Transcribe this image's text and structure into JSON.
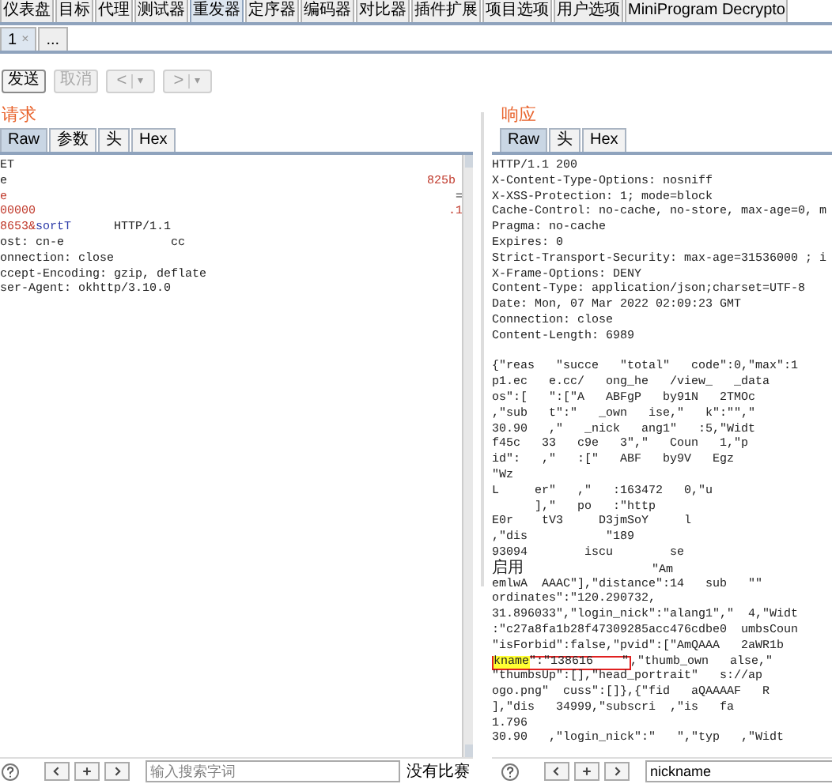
{
  "main_tabs": [
    {
      "label": "仪表盘",
      "selected": false
    },
    {
      "label": "目标",
      "selected": false
    },
    {
      "label": "代理",
      "selected": false
    },
    {
      "label": "测试器",
      "selected": false
    },
    {
      "label": "重发器",
      "selected": true
    },
    {
      "label": "定序器",
      "selected": false
    },
    {
      "label": "编码器",
      "selected": false
    },
    {
      "label": "对比器",
      "selected": false
    },
    {
      "label": "插件扩展",
      "selected": false
    },
    {
      "label": "项目选项",
      "selected": false
    },
    {
      "label": "用户选项",
      "selected": false
    },
    {
      "label": "MiniProgram Decrypto",
      "selected": false
    }
  ],
  "sub_tabs": [
    {
      "label": "1",
      "close": "×",
      "selected": true
    },
    {
      "label": "...",
      "selected": false
    }
  ],
  "toolbar": {
    "send": {
      "label": "发送",
      "disabled": false
    },
    "cancel": {
      "label": "取消",
      "disabled": true
    },
    "back": {
      "label": "<",
      "caret": "▾"
    },
    "forward": {
      "label": ">",
      "caret": "▾"
    }
  },
  "request": {
    "title": "请求",
    "tabs": [
      {
        "label": "Raw",
        "selected": true
      },
      {
        "label": "参数",
        "selected": false
      },
      {
        "label": "头",
        "selected": false
      },
      {
        "label": "Hex",
        "selected": false
      }
    ],
    "lines": [
      [
        {
          "text": "ET",
          "kind": "plain"
        }
      ],
      [
        {
          "text": "e",
          "kind": "plain"
        },
        {
          "text": "                                                           825b",
          "kind": "value"
        }
      ],
      [
        {
          "text": "e",
          "kind": "value"
        },
        {
          "text": "                                                               =",
          "kind": "plain"
        }
      ],
      [
        {
          "text": "00000",
          "kind": "value"
        },
        {
          "text": "                                                          .1",
          "kind": "value"
        }
      ],
      [
        {
          "text": "8653&",
          "kind": "value"
        },
        {
          "text": "sortT",
          "kind": "name"
        },
        {
          "text": "      HTTP/1.1",
          "kind": "plain"
        }
      ],
      [
        {
          "text": "ost: cn-e",
          "kind": "plain"
        },
        {
          "text": "               cc",
          "kind": "plain"
        }
      ],
      [
        {
          "text": "onnection: close",
          "kind": "plain"
        }
      ],
      [
        {
          "text": "ccept-Encoding: gzip, deflate",
          "kind": "plain"
        }
      ],
      [
        {
          "text": "ser-Agent: okhttp/3.10.0",
          "kind": "plain"
        }
      ]
    ],
    "search": {
      "placeholder": "输入搜索字词",
      "status": "没有比赛"
    }
  },
  "response": {
    "title": "响应",
    "tabs": [
      {
        "label": "Raw",
        "selected": true
      },
      {
        "label": "头",
        "selected": false
      },
      {
        "label": "Hex",
        "selected": false
      }
    ],
    "headers": [
      "HTTP/1.1 200",
      "X-Content-Type-Options: nosniff",
      "X-XSS-Protection: 1; mode=block",
      "Cache-Control: no-cache, no-store, max-age=0, m",
      "Pragma: no-cache",
      "Expires: 0",
      "Strict-Transport-Security: max-age=31536000 ; i",
      "X-Frame-Options: DENY",
      "Content-Type: application/json;charset=UTF-8",
      "Date: Mon, 07 Mar 2022 02:09:23 GMT",
      "Connection: close",
      "Content-Length: 6989"
    ],
    "body": [
      [
        {
          "text": "{\"reas   \"succe   \"total\"   code\":0,\"max\":1",
          "kind": "plain"
        }
      ],
      [
        {
          "text": "p1.ec   e.cc/   ong_he   /view_   _data",
          "kind": "plain"
        }
      ],
      [
        {
          "text": "os\":[   \":[\"A   ABFgP   by91N   2TMOc",
          "kind": "plain"
        }
      ],
      [
        {
          "text": ",\"sub   t\":\"   _own   ise,\"   k\":\"\",\"",
          "kind": "plain"
        }
      ],
      [
        {
          "text": "30.90   ,\"   _nick   ang1\"   :5,\"Widt",
          "kind": "plain"
        }
      ],
      [
        {
          "text": "f45c   33   c9e   3\",\"   Coun   1,\"p",
          "kind": "plain"
        }
      ],
      [
        {
          "text": "id\":   ,\"   :[\"   ABF   by9V   Egz",
          "kind": "plain"
        }
      ],
      [
        {
          "text": "\"Wz",
          "kind": "plain"
        }
      ],
      [
        {
          "text": "L     er\"   ,\"   :163472   0,\"u",
          "kind": "plain"
        }
      ],
      [
        {
          "text": "      ],\"   po   :\"http",
          "kind": "plain"
        }
      ],
      [
        {
          "text": "E0r    tV3     D3jmSoY     l",
          "kind": "plain"
        }
      ],
      [
        {
          "text": ",\"dis           \"189",
          "kind": "plain"
        }
      ],
      [
        {
          "text": "93094        iscu        se",
          "kind": "plain"
        }
      ],
      [
        {
          "text": "启用",
          "kind": "wide"
        },
        {
          "text": "                  \"Am",
          "kind": "plain"
        }
      ],
      [
        {
          "text": "emlwA  AAAC\"],\"distance\":14   sub   \"\"",
          "kind": "plain"
        }
      ],
      [
        {
          "text": "ordinates\":\"120.290732,",
          "kind": "plain"
        }
      ],
      [
        {
          "text": "31.896033\",\"login_nick\":\"alang1\",\"  4,\"Widt",
          "kind": "plain"
        }
      ],
      [
        {
          "text": ":\"c27a8fa1b28f47309285acc476cdbe0  umbsCoun",
          "kind": "plain"
        }
      ],
      [
        {
          "text": "\"isForbid\":false,\"pvid\":[\"AmQAAA   2aWR1b",
          "kind": "plain"
        }
      ],
      [
        {
          "text": "kname",
          "kind": "match"
        },
        {
          "text": "\":\"138616    \"",
          "kind": "boxed"
        },
        {
          "text": ",\"thumb_own   alse,\"",
          "kind": "plain"
        }
      ],
      [
        {
          "text": "\"thumbsUp\":[],\"head_portrait\"   s://ap",
          "kind": "plain"
        }
      ],
      [
        {
          "text": "ogo.png\"  cuss\":[]},{\"fid   aQAAAAF   R",
          "kind": "plain"
        }
      ],
      [
        {
          "text": "],\"dis   34999,\"subscri  ,\"is   fa",
          "kind": "plain"
        }
      ],
      [
        {
          "text": "1.796",
          "kind": "plain"
        }
      ],
      [
        {
          "text": "30.90   ,\"login_nick\":\"   \",\"typ   ,\"Widt",
          "kind": "plain"
        }
      ]
    ],
    "search": {
      "value": "nickname"
    }
  }
}
